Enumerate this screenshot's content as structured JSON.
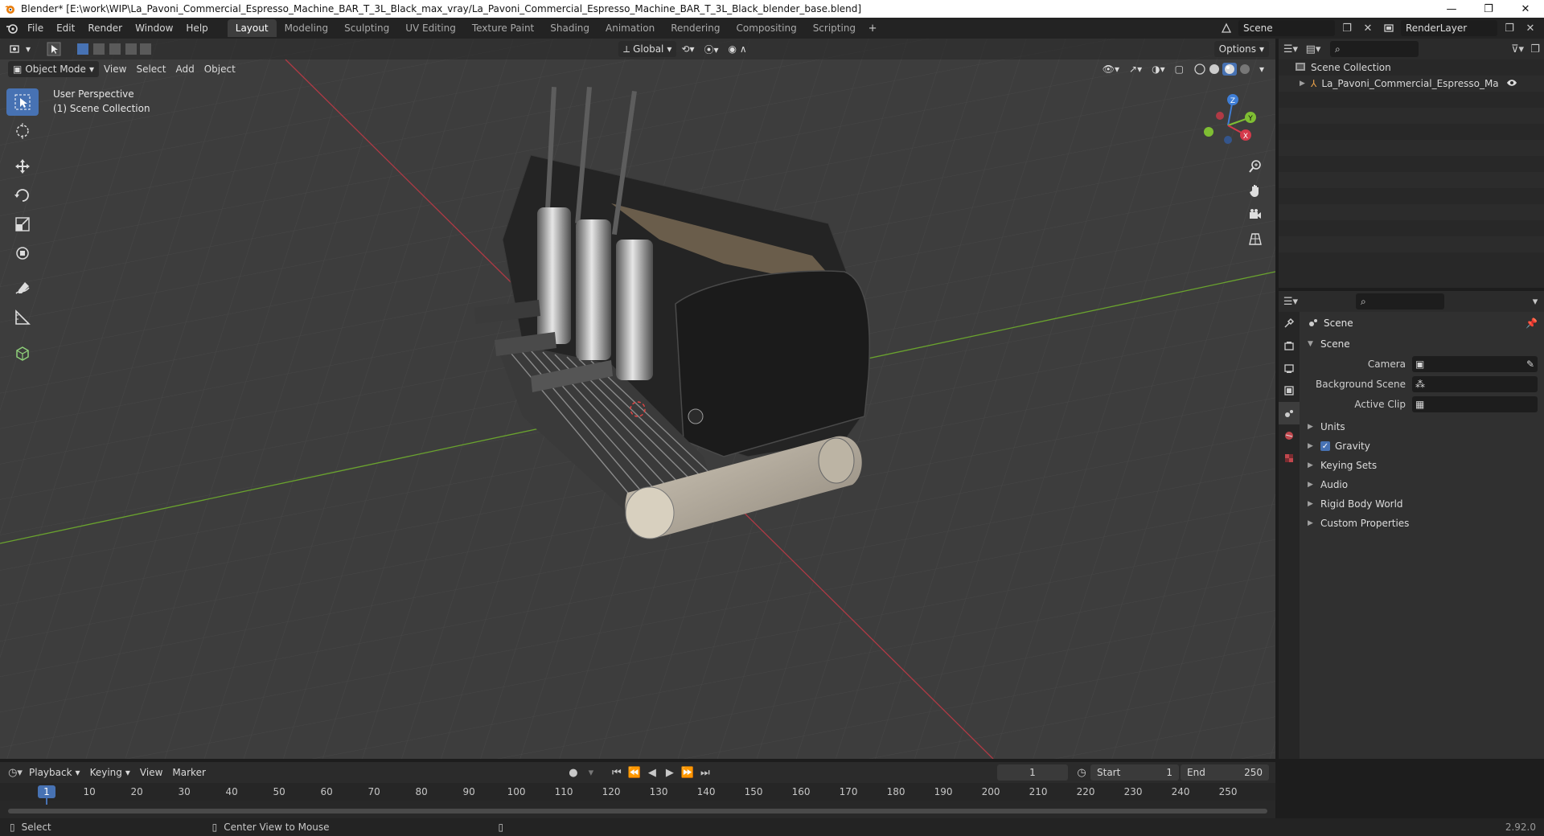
{
  "titlebar": {
    "title": "Blender* [E:\\work\\WIP\\La_Pavoni_Commercial_Espresso_Machine_BAR_T_3L_Black_max_vray/La_Pavoni_Commercial_Espresso_Machine_BAR_T_3L_Black_blender_base.blend]",
    "minimize": "—",
    "maximize": "❐",
    "close": "✕"
  },
  "menu": [
    "File",
    "Edit",
    "Render",
    "Window",
    "Help"
  ],
  "workspaces": [
    "Layout",
    "Modeling",
    "Sculpting",
    "UV Editing",
    "Texture Paint",
    "Shading",
    "Animation",
    "Rendering",
    "Compositing",
    "Scripting"
  ],
  "topright": {
    "scene": "Scene",
    "view_layer": "RenderLayer"
  },
  "viewport": {
    "mode": "Object Mode",
    "menus": [
      "View",
      "Select",
      "Add",
      "Object"
    ],
    "orientation": "Global",
    "options": "Options",
    "info_line1": "User Perspective",
    "info_line2": "(1) Scene Collection",
    "gizmo": {
      "z": "Z",
      "y": "Y",
      "x": "X"
    }
  },
  "outliner": {
    "root": "Scene Collection",
    "items": [
      "La_Pavoni_Commercial_Espresso_Machine_B"
    ]
  },
  "properties": {
    "context": "Scene",
    "panel_scene": "Scene",
    "rows": [
      {
        "label": "Camera"
      },
      {
        "label": "Background Scene"
      },
      {
        "label": "Active Clip"
      }
    ],
    "subpanels": [
      "Units",
      "Gravity",
      "Keying Sets",
      "Audio",
      "Rigid Body World",
      "Custom Properties"
    ]
  },
  "timeline": {
    "menus": [
      "Playback",
      "Keying",
      "View",
      "Marker"
    ],
    "current_frame": "1",
    "start_label": "Start",
    "start": "1",
    "end_label": "End",
    "end": "250",
    "ticks": [
      "1",
      "10",
      "20",
      "30",
      "40",
      "50",
      "60",
      "70",
      "80",
      "90",
      "100",
      "110",
      "120",
      "130",
      "140",
      "150",
      "160",
      "170",
      "180",
      "190",
      "200",
      "210",
      "220",
      "230",
      "240",
      "250"
    ]
  },
  "statusbar": {
    "left": "Select",
    "middle": "Center View to Mouse",
    "version": "2.92.0"
  },
  "colors": {
    "accent": "#4772b3",
    "x_axis": "#d43a4b",
    "y_axis": "#7fbe33",
    "z_axis": "#3f7ed6"
  }
}
